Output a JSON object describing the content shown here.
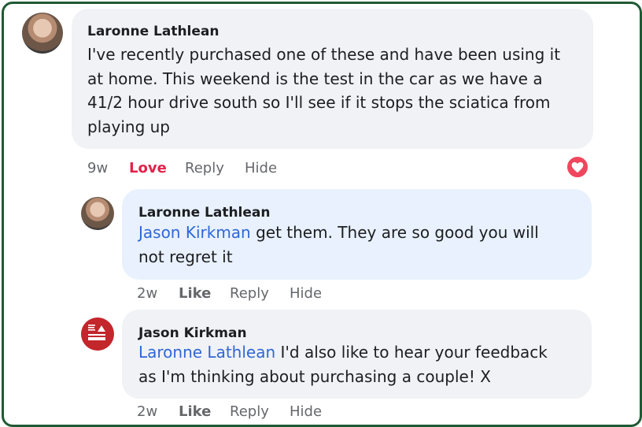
{
  "comments": [
    {
      "author": "Laronne Lathlean",
      "lines": [
        "I've recently purchased one of these and have been using it",
        "at home. This weekend is the test in the car as we have a",
        "41/2 hour drive south so I'll see if it stops the sciatica from",
        "playing up"
      ],
      "actions": {
        "time": "9w",
        "reaction": "Love",
        "reply": "Reply",
        "hide": "Hide"
      },
      "reaction_icon": "heart-icon",
      "reaction_color": "#f0475f"
    },
    {
      "author": "Laronne Lathlean",
      "mention": "Jason Kirkman",
      "line1_rest": " get them. They are so good you will",
      "line2": "not regret it",
      "actions": {
        "time": "2w",
        "like": "Like",
        "reply": "Reply",
        "hide": "Hide"
      }
    },
    {
      "author": "Jason Kirkman",
      "mention": "Laronne Lathlean",
      "line1_rest": " I'd also like to hear your feedback",
      "line2": "as I'm thinking about purchasing a couple! X",
      "actions": {
        "time": "2w",
        "like": "Like",
        "reply": "Reply",
        "hide": "Hide"
      }
    }
  ],
  "colors": {
    "frame_border": "#1f5a34",
    "mention": "#2f67d8",
    "love": "#e0244b",
    "bubble_gray": "#f0f2f5",
    "bubble_blue": "#e8f1fd"
  }
}
